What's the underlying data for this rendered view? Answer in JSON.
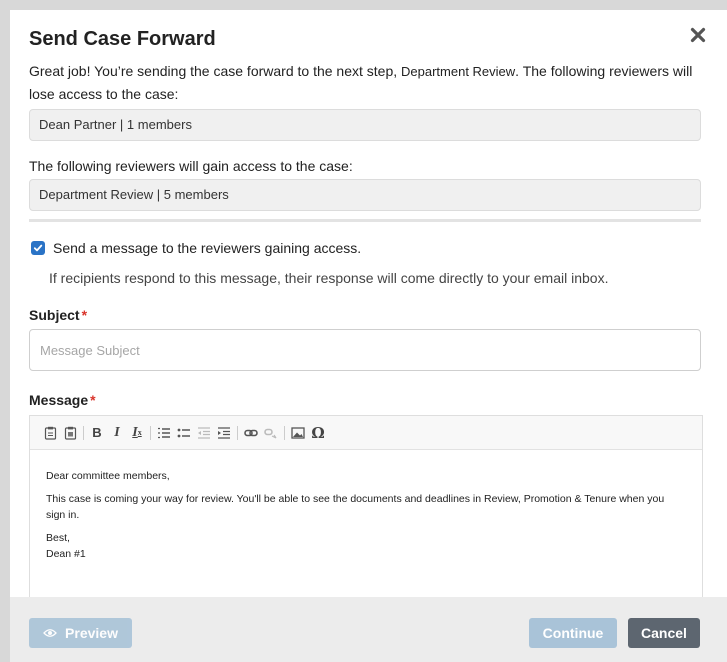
{
  "modal": {
    "title": "Send Case Forward",
    "close_icon": "close-icon"
  },
  "intro": {
    "part1": "Great job! You’re sending the case forward to the next step, ",
    "step_name": "Department Review",
    "part2": ". The following reviewers will lose access to the case:"
  },
  "lose_access": {
    "value": "Dean Partner | 1 members"
  },
  "gain_access": {
    "label": "The following reviewers will gain access to the case:",
    "value": "Department Review | 5 members"
  },
  "send_message": {
    "checked": true,
    "label": "Send a message to the reviewers gaining access.",
    "helper": "If recipients respond to this message, their response will come directly to your email inbox."
  },
  "subject": {
    "label": "Subject",
    "required_mark": "*",
    "placeholder": "Message Subject",
    "value": ""
  },
  "message": {
    "label": "Message",
    "required_mark": "*",
    "toolbar_icons": [
      "paste-icon",
      "paste-text-icon",
      "bold-icon",
      "italic-icon",
      "remove-format-icon",
      "numbered-list-icon",
      "bulleted-list-icon",
      "outdent-icon",
      "indent-icon",
      "link-icon",
      "unlink-icon",
      "image-icon",
      "special-char-icon"
    ],
    "toolbar_text": {
      "bold": "B",
      "italic": "I",
      "remove_format": "I",
      "special_char": "Ω"
    },
    "content": {
      "greeting": "Dear committee members,",
      "paragraph": "This case is coming your way for review. You'll be able to see the documents and deadlines in Review, Promotion & Tenure when you sign in.",
      "closing": "Best,",
      "signature": "Dean #1"
    }
  },
  "footer": {
    "preview_label": "Preview",
    "continue_label": "Continue",
    "cancel_label": "Cancel"
  },
  "colors": {
    "checkbox": "#2a73c6",
    "required": "#d9342b",
    "disabled_button": "#a9c3d8",
    "cancel_button": "#5d6670",
    "footer_bg": "#ececec"
  }
}
